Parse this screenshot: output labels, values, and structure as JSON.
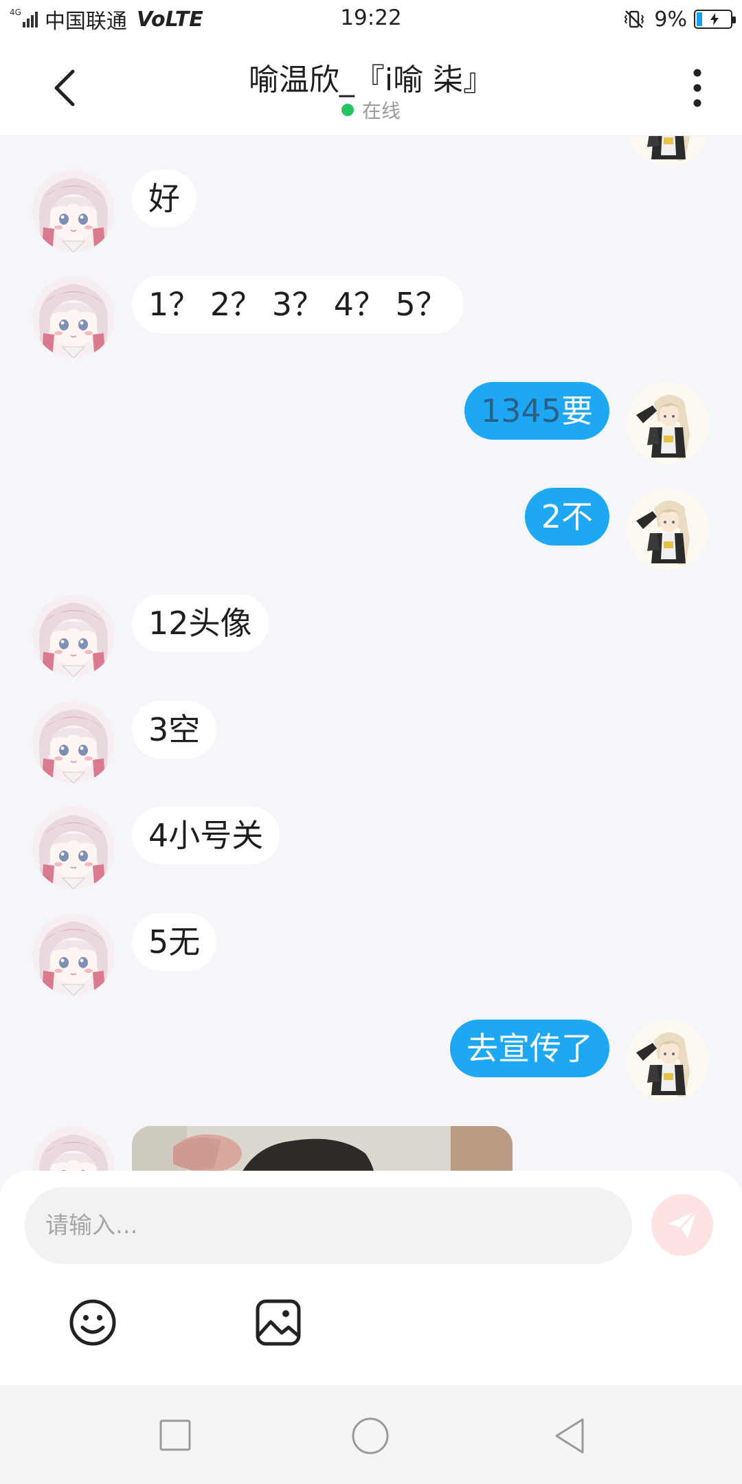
{
  "status_bar": {
    "network": "4G",
    "carrier": "中国联通",
    "volte": "VoLTE",
    "time": "19:22",
    "battery": "9%",
    "icons": [
      "signal-icon",
      "vibrate-icon",
      "battery-charging-icon"
    ]
  },
  "header": {
    "title": "喻温欣_『i喻 柒』",
    "status": "在线",
    "status_color": "#22c55e",
    "icons": [
      "back-arrow-icon",
      "more-vertical-icon"
    ]
  },
  "messages": [
    {
      "side": "in",
      "text": "好"
    },
    {
      "side": "in",
      "text": "1？ 2？ 3？ 4？ 5？"
    },
    {
      "side": "out",
      "text_dim": "1345",
      "text": "要"
    },
    {
      "side": "out",
      "text": "2不"
    },
    {
      "side": "in",
      "text": "12头像"
    },
    {
      "side": "in",
      "text": "3空"
    },
    {
      "side": "in",
      "text": "4小号关"
    },
    {
      "side": "in",
      "text": "5无"
    },
    {
      "side": "out",
      "text": "去宣传了"
    },
    {
      "side": "in",
      "type": "image"
    }
  ],
  "composer": {
    "placeholder": "请输入...",
    "send_icon": "send-icon",
    "tools": [
      "emoji-icon",
      "image-icon"
    ]
  },
  "nav_bar": {
    "icons": [
      "recent-apps-icon",
      "home-icon",
      "back-triangle-icon"
    ]
  },
  "colors": {
    "accent": "#1ea8f4",
    "background": "#f4f6f9",
    "send_button": "#fde3e1"
  }
}
